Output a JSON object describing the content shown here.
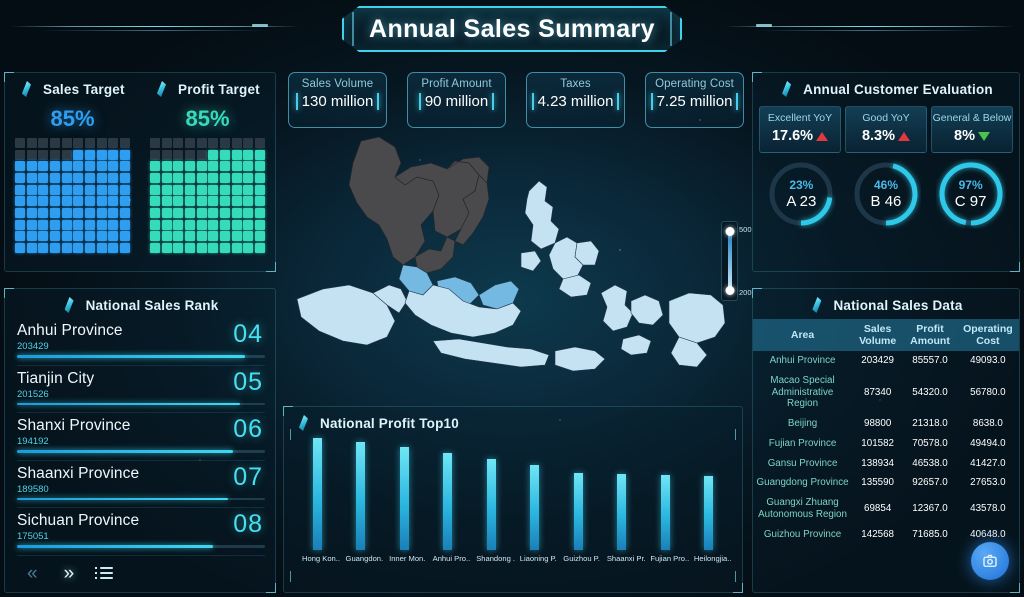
{
  "header": {
    "title": "Annual Sales Summary"
  },
  "targets": {
    "sales": {
      "label": "Sales Target",
      "percent_text": "85%",
      "percent": 85,
      "icon": "diamond-icon",
      "color": "#2f9ef0"
    },
    "profit": {
      "label": "Profit Target",
      "percent_text": "85%",
      "percent": 85,
      "icon": "diamond-icon",
      "color": "#36dbbb"
    }
  },
  "kpis": [
    {
      "label": "Sales Volume",
      "value": "130 million"
    },
    {
      "label": "Profit Amount",
      "value": "90 million"
    },
    {
      "label": "Taxes",
      "value": "4.23 million"
    },
    {
      "label": "Operating Cost",
      "value": "7.25 million"
    }
  ],
  "rank": {
    "title": "National Sales Rank",
    "icon": "diamond-icon",
    "items": [
      {
        "name": "Anhui Province",
        "value": "203429",
        "rank": "04",
        "pct": 92
      },
      {
        "name": "Tianjin City",
        "value": "201526",
        "rank": "05",
        "pct": 90
      },
      {
        "name": "Shanxi Province",
        "value": "194192",
        "rank": "06",
        "pct": 87
      },
      {
        "name": "Shaanxi Province",
        "value": "189580",
        "rank": "07",
        "pct": 85
      },
      {
        "name": "Sichuan Province",
        "value": "175051",
        "rank": "08",
        "pct": 79
      }
    ],
    "nav": {
      "prev": "«",
      "next": "»",
      "list": "list-icon"
    }
  },
  "map": {
    "legend": {
      "max": "500",
      "min": "200"
    }
  },
  "evaluation": {
    "title": "Annual Customer Evaluation",
    "icon": "diamond-icon",
    "chips": [
      {
        "label": "Excellent YoY",
        "value": "17.6%",
        "trend": "up"
      },
      {
        "label": "Good YoY",
        "value": "8.3%",
        "trend": "up"
      },
      {
        "label": "General & Below",
        "value": "8%",
        "trend": "down"
      }
    ],
    "donuts": [
      {
        "percent_text": "23%",
        "percent": 23,
        "name": "A 23"
      },
      {
        "percent_text": "46%",
        "percent": 46,
        "name": "B 46"
      },
      {
        "percent_text": "97%",
        "percent": 97,
        "name": "C 97"
      }
    ]
  },
  "table": {
    "title": "National Sales Data",
    "icon": "diamond-icon",
    "columns": [
      "Area",
      "Sales Volume",
      "Profit Amount",
      "Operating Cost"
    ],
    "rows": [
      {
        "area": "Anhui Province",
        "sales": "203429",
        "profit": "85557.0",
        "cost": "49093.0"
      },
      {
        "area": "Macao Special Administrative Region",
        "sales": "87340",
        "profit": "54320.0",
        "cost": "56780.0"
      },
      {
        "area": "Beijing",
        "sales": "98800",
        "profit": "21318.0",
        "cost": "8638.0"
      },
      {
        "area": "Fujian Province",
        "sales": "101582",
        "profit": "70578.0",
        "cost": "49494.0"
      },
      {
        "area": "Gansu Province",
        "sales": "138934",
        "profit": "46538.0",
        "cost": "41427.0"
      },
      {
        "area": "Guangdong Province",
        "sales": "135590",
        "profit": "92657.0",
        "cost": "27653.0"
      },
      {
        "area": "Guangxi Zhuang Autonomous Region",
        "sales": "69854",
        "profit": "12367.0",
        "cost": "43578.0"
      },
      {
        "area": "Guizhou Province",
        "sales": "142568",
        "profit": "71685.0",
        "cost": "40648.0"
      }
    ],
    "fab_icon": "camera-icon"
  },
  "chart_data": {
    "type": "bar",
    "title": "National Profit Top10",
    "categories": [
      "Hong Kon..",
      "Guangdon.",
      "Inner Mon.",
      "Anhui Pro..",
      "Shandong .",
      "Liaoning P.",
      "Guizhou P.",
      "Shaanxi Pr.",
      "Fujian Pro..",
      "Heilongjia.."
    ],
    "values": [
      100,
      96,
      92,
      87,
      81,
      76,
      69,
      68,
      67,
      66
    ],
    "xlabel": "",
    "ylabel": "",
    "ylim": [
      0,
      100
    ],
    "grid": false,
    "legend": false
  }
}
